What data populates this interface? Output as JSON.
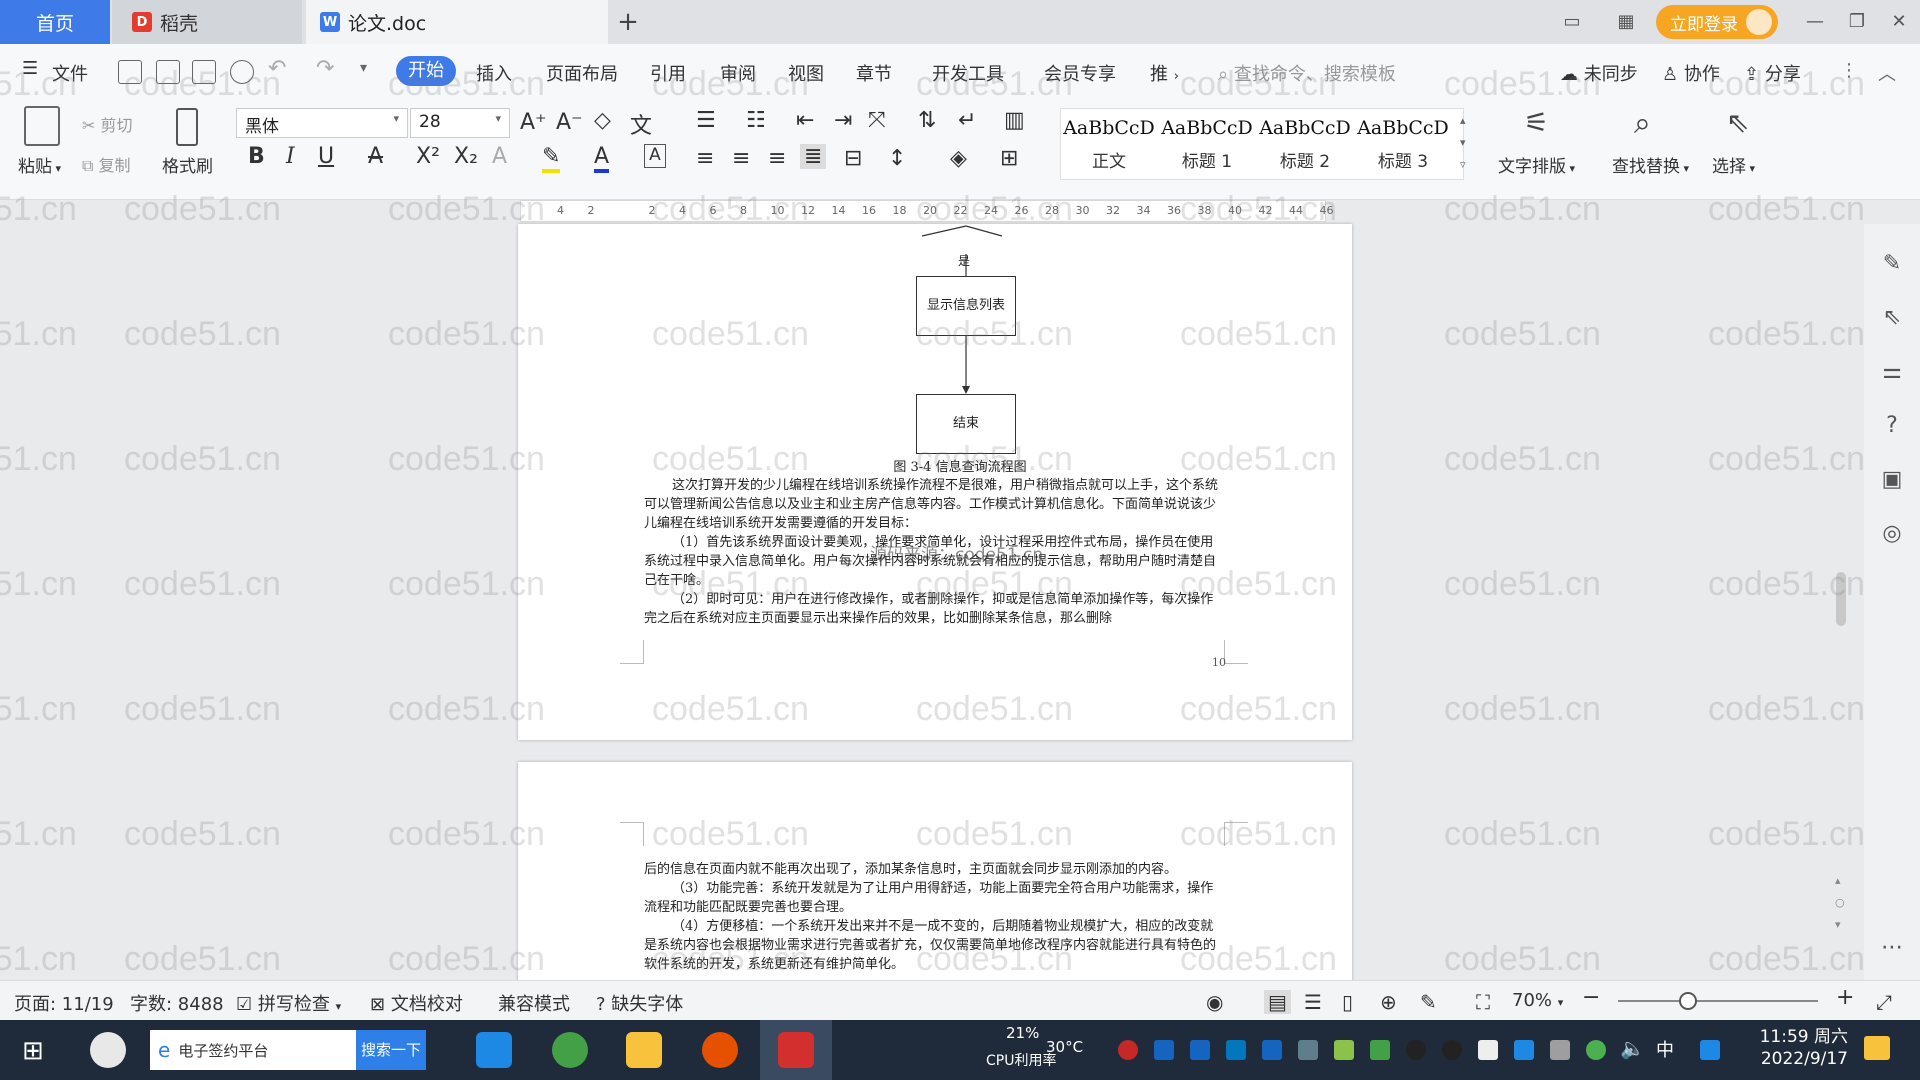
{
  "tabs": {
    "home": "首页",
    "daoke": "稻壳",
    "doc": "论文.doc"
  },
  "titlebar": {
    "login": "立即登录"
  },
  "menu": {
    "file": "文件",
    "items": [
      "开始",
      "插入",
      "页面布局",
      "引用",
      "审阅",
      "视图",
      "章节",
      "开发工具",
      "会员专享",
      "推"
    ],
    "search_cmd": "查找命令、搜索模板",
    "unsynced": "未同步",
    "collab": "协作",
    "share": "分享"
  },
  "ribbon": {
    "paste": "粘贴",
    "cut": "剪切",
    "copy": "复制",
    "format_painter": "格式刷",
    "font": "黑体",
    "size": "28",
    "styles": [
      {
        "sample": "AaBbCcD",
        "name": "正文"
      },
      {
        "sample": "AaBbCcD",
        "name": "标题 1"
      },
      {
        "sample": "AaBbCcD",
        "name": "标题 2"
      },
      {
        "sample": "AaBbCcD",
        "name": "标题 3"
      }
    ],
    "text_layout": "文字排版",
    "find_replace": "查找替换",
    "select": "选择"
  },
  "ruler": {
    "ticks": [
      "4",
      "2",
      "",
      "2",
      "4",
      "6",
      "8",
      "10",
      "12",
      "14",
      "16",
      "18",
      "20",
      "22",
      "24",
      "26",
      "28",
      "30",
      "32",
      "34",
      "36",
      "38",
      "40",
      "42",
      "44",
      "46"
    ]
  },
  "document": {
    "flow_yes": "是",
    "flow_box1": "显示信息列表",
    "flow_box2": "结束",
    "caption": "图 3-4  信息查询流程图",
    "para1": "这次打算开发的少儿编程在线培训系统操作流程不是很难，用户稍微指点就可以上手，这个系统可以管理新闻公告信息以及业主和业主房产信息等内容。工作模式计算机信息化。下面简单说说该少儿编程在线培训系统开发需要遵循的开发目标：",
    "para2": "（1）首先该系统界面设计要美观，操作要求简单化，设计过程采用控件式布局，操作员在使用系统过程中录入信息简单化。用户每次操作内容时系统就会有相应的提示信息，帮助用户随时清楚自己在干啥。",
    "para3": "（2）即时可见：用户在进行修改操作，或者删除操作，抑或是信息简单添加操作等，每次操作完之后在系统对应主页面要显示出来操作后的效果，比如删除某条信息，那么删除",
    "overlay": "源码来源：code51.cn",
    "page_number": "10",
    "para4": "后的信息在页面内就不能再次出现了，添加某条信息时，主页面就会同步显示刚添加的内容。",
    "para5": "（3）功能完善：系统开发就是为了让用户用得舒适，功能上面要完全符合用户功能需求，操作流程和功能匹配既要完善也要合理。",
    "para6": "（4）方便移植：一个系统开发出来并不是一成不变的，后期随着物业规模扩大，相应的改变就是系统内容也会根据物业需求进行完善或者扩充，仅仅需要简单地修改程序内容就能进行具有特色的软件系统的开发，系统更新还有维护简单化。"
  },
  "watermark": "code51.cn",
  "status": {
    "page": "页面: 11/19",
    "words": "字数: 8488",
    "spell": "拼写检查",
    "proof": "文档校对",
    "compat": "兼容模式",
    "missing_font": "缺失字体",
    "zoom": "70%"
  },
  "taskbar": {
    "search_text": "电子签约平台",
    "search_btn": "搜索一下",
    "cpu": "21%",
    "cpu_label": "CPU利用率",
    "temp": "30°C",
    "ime": "中",
    "time": "11:59 周六",
    "date": "2022/9/17"
  },
  "colors": {
    "accent": "#3f7be8",
    "login": "#f6a623",
    "taskbar": "#1f2a3a"
  }
}
